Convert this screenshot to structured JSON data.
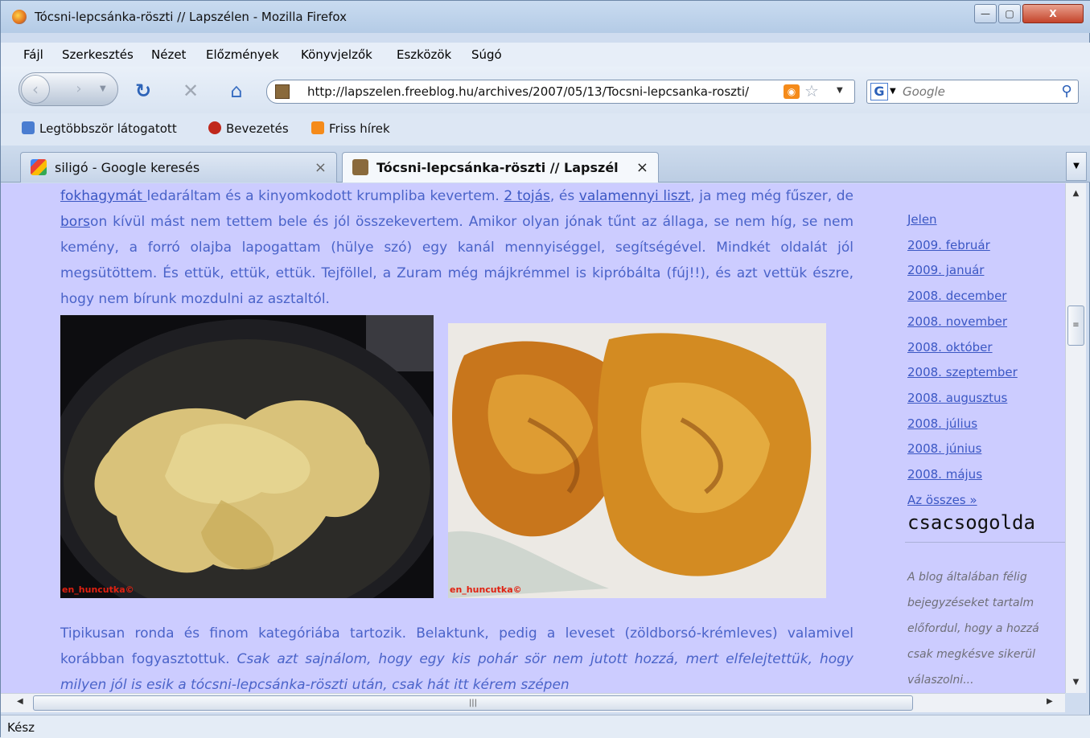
{
  "window": {
    "title": "Tócsni-lepcsánka-röszti // Lapszélen - Mozilla Firefox",
    "min_label": "—",
    "max_label": "▢",
    "close_label": "X"
  },
  "menu": [
    {
      "label": "Fájl"
    },
    {
      "label": "Szerkesztés"
    },
    {
      "label": "Nézet"
    },
    {
      "label": "Előzmények"
    },
    {
      "label": "Könyvjelzők"
    },
    {
      "label": "Eszközök"
    },
    {
      "label": "Súgó"
    }
  ],
  "nav": {
    "url": "http://lapszelen.freeblog.hu/archives/2007/05/13/Tocsni-lepcsanka-roszti/",
    "search_placeholder": "Google",
    "search_engine_letter": "G"
  },
  "bookmarks": [
    {
      "label": "Legtöbbször látogatott"
    },
    {
      "label": "Bevezetés"
    },
    {
      "label": "Friss hírek"
    }
  ],
  "tabs": [
    {
      "label": "siligó - Google keresés",
      "active": false
    },
    {
      "label": "Tócsni-lepcsánka-röszti // Lapszél...",
      "active": true
    }
  ],
  "post": {
    "p1": {
      "link_fokhagymat": "fokhagymát ",
      "t1": "ledaráltam és a kinyomkodott krumpliba kevertem. ",
      "link_tojas": "2 tojás",
      "t2": ", és ",
      "link_liszt": "valamennyi liszt",
      "t3": ", ja meg még fűszer, de ",
      "link_bors": "bors",
      "t4": "on kívül mást nem tettem bele és jól összekevertem. Amikor olyan jónak tűnt az állaga, se nem híg, se nem kemény, a forró olajba lapogattam (hülye szó) egy kanál mennyiséggel, segítségével. Mindkét oldalát jól megsütöttem. És ettük, ettük, ettük. Tejföllel, a Zuram még májkrémmel is kipróbálta (fúj!!), és azt vettük észre, hogy nem bírunk mozdulni az asztaltól."
    },
    "photo_watermark_1": "en_huncutka©",
    "photo_watermark_2": "en_huncutka©",
    "p2": {
      "t1": "Tipikusan ronda és finom kategóriába tartozik. Belaktunk, pedig a leveset (zöldborsó-krémleves) valamivel korábban fogyasztottuk. ",
      "it1": "Csak azt sajnálom, hogy egy kis pohár sör nem jutott hozzá, mert elfelejtettük, hogy  milyen jól is esik a tócsni-lepcsánka-röszti után, csak hát itt kérem szépen"
    }
  },
  "sidebar": {
    "archive": [
      "Jelen",
      "2009. február",
      "2009. január",
      "2008. december",
      "2008. november",
      "2008. október",
      "2008. szeptember",
      "2008. augusztus",
      "2008. július",
      "2008. június",
      "2008. május",
      "Az összes »"
    ],
    "heading": "csacsogolda",
    "desc_lines": [
      "A blog általában félig",
      "bejegyzéseket tartalm",
      "előfordul, hogy a hozzá",
      "csak megkésve sikerül",
      "válaszolni..."
    ]
  },
  "status": "Kész"
}
